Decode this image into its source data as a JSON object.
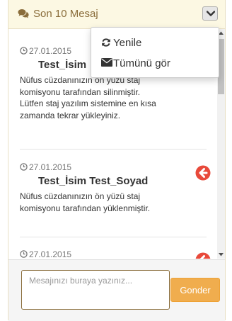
{
  "header": {
    "title": "Son 10 Mesaj",
    "icon": "comments-icon",
    "toggle_icon": "chevron-down-icon"
  },
  "dropdown": {
    "items": [
      {
        "label": "Yenile",
        "icon": "refresh-icon"
      },
      {
        "label": "Tümünü gör",
        "icon": "envelope-icon"
      }
    ]
  },
  "messages": [
    {
      "date": "27.01.2015",
      "name": "Test_İsim",
      "text": "Nüfus cüzdanınızın ön yüzü staj komisyonu tarafından silinmiştir. Lütfen staj yazılım sistemine en kısa zamanda tekrar yükleyiniz."
    },
    {
      "date": "27.01.2015",
      "name": "Test_İsim Test_Soyad",
      "text": "Nüfus cüzdanınızın ön yüzü staj komisyonu tarafından yüklenmiştir.",
      "action_icon": "arrow-circle-left-icon"
    },
    {
      "date": "27.01.2015",
      "action_icon": "arrow-circle-left-icon"
    }
  ],
  "composer": {
    "placeholder": "Mesajınızı buraya yazınız...",
    "send_label": "Gonder"
  },
  "colors": {
    "header_bg": "#fcf8e3",
    "header_text": "#8a6d3b",
    "send_button": "#f0ad4e",
    "action_icon": "#e8493a"
  }
}
